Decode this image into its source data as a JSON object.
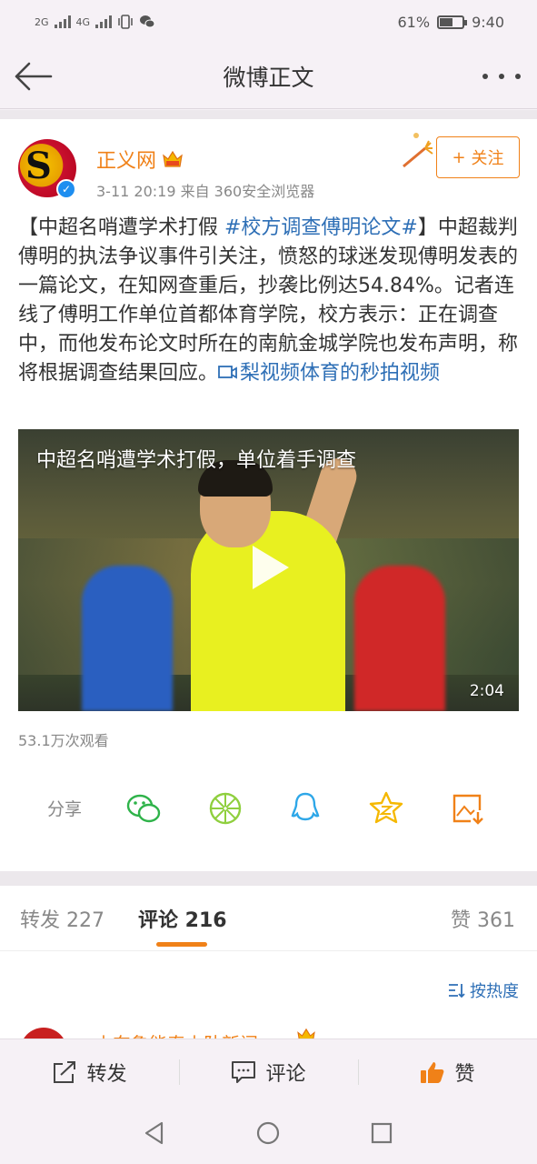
{
  "status_bar": {
    "signal1": "2G",
    "signal2": "4G",
    "battery_percent": "61%",
    "battery_level": 0.61,
    "time": "9:40"
  },
  "header": {
    "title": "微博正文"
  },
  "post": {
    "author": "正义网",
    "meta": "3-11 20:19   来自 360安全浏览器",
    "follow_label": "关注",
    "follow_plus": "+",
    "text_prefix": "【中超名哨遭学术打假 ",
    "hashtag": "#校方调查傅明论文#",
    "text_body": "】中超裁判傅明的执法争议事件引关注，愤怒的球迷发现傅明发表的一篇论文，在知网查重后，抄袭比例达54.84%。记者连线了傅明工作单位首都体育学院，校方表示：正在调查中，而他发布论文时所在的南航金城学院也发布声明，称将根据调查结果回应。",
    "video_link": "梨视频体育的秒拍视频",
    "video_caption": "中超名哨遭学术打假，单位着手调查",
    "video_duration": "2:04",
    "views": "53.1万次观看"
  },
  "share": {
    "label": "分享",
    "icons": [
      "wechat-icon",
      "moments-icon",
      "qq-icon",
      "qzone-icon",
      "save-image-icon"
    ]
  },
  "tabs": {
    "repost": "转发 227",
    "comments": "评论 216",
    "likes": "赞 361"
  },
  "sort": {
    "label": "按热度"
  },
  "comment_preview": {
    "author": "山东鲁能泰山队新闻"
  },
  "action_bar": {
    "repost": "转发",
    "comment": "评论",
    "like": "赞"
  },
  "colors": {
    "accent": "#f08118",
    "link": "#2e6fb6",
    "background": "#f6f1f6"
  }
}
